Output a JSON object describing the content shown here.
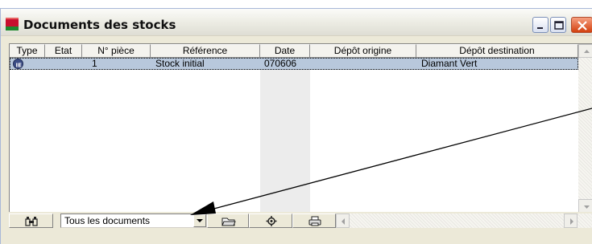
{
  "window": {
    "title": "Documents des stocks",
    "app_icon": "red-green-window-icon",
    "buttons": {
      "minimize": "minimize-icon",
      "maximize": "maximize-icon",
      "close": "close-icon"
    }
  },
  "table": {
    "columns": [
      "Type",
      "Etat",
      "N° pièce",
      "Référence",
      "Date",
      "Dépôt origine",
      "Dépôt destination"
    ],
    "rows": [
      {
        "type_icon": "stock-entry-icon",
        "etat": "",
        "numero": "1",
        "reference": "Stock initial",
        "date": "070606",
        "depot_origine": "",
        "depot_destination": "Diamant Vert",
        "selected": true
      }
    ]
  },
  "toolbar": {
    "find_icon": "binoculars-icon",
    "filter_value": "Tous les documents",
    "buttons": [
      "open-document-icon",
      "settings-icon",
      "print-icon"
    ]
  },
  "colors": {
    "selection": "#b8c8dc",
    "window_bg": "#ece9d8",
    "annotation_arrow": "#000000"
  }
}
